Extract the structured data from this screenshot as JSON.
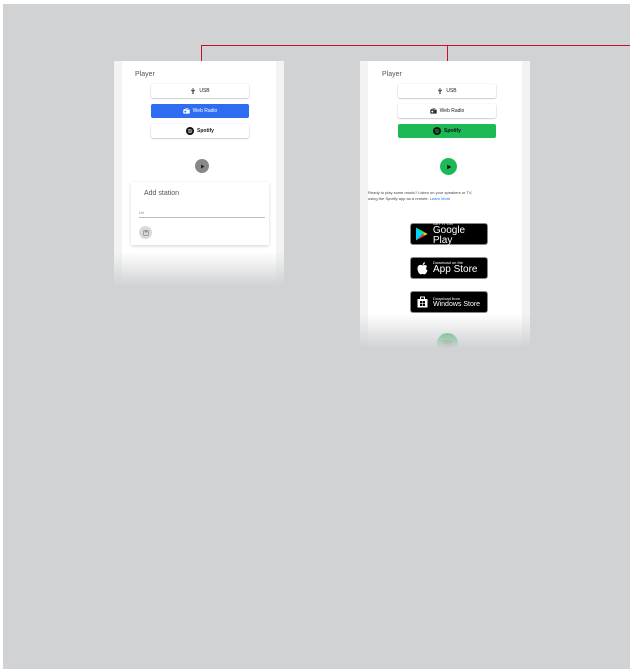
{
  "player_title": "Player",
  "sources": {
    "usb": "USB",
    "web_radio": "Web Radio",
    "spotify": "Spotify"
  },
  "add_station": {
    "title": "Add station",
    "field_label": "Url",
    "field_value": ""
  },
  "spotify_info": {
    "text": "Ready to play some music? Listen on your speakers or TV,",
    "text2": "using the Spotify app as a remote.",
    "learn_more": "Learn More"
  },
  "stores": {
    "google_small": "GET IT ON",
    "google_big": "Google Play",
    "apple_small": "Download on the",
    "apple_big": "App Store",
    "windows_small": "Download from",
    "windows_big": "Windows Store"
  },
  "colors": {
    "callout": "#c8102e",
    "web_radio_active": "#2e6df2",
    "spotify_green": "#1db954"
  }
}
